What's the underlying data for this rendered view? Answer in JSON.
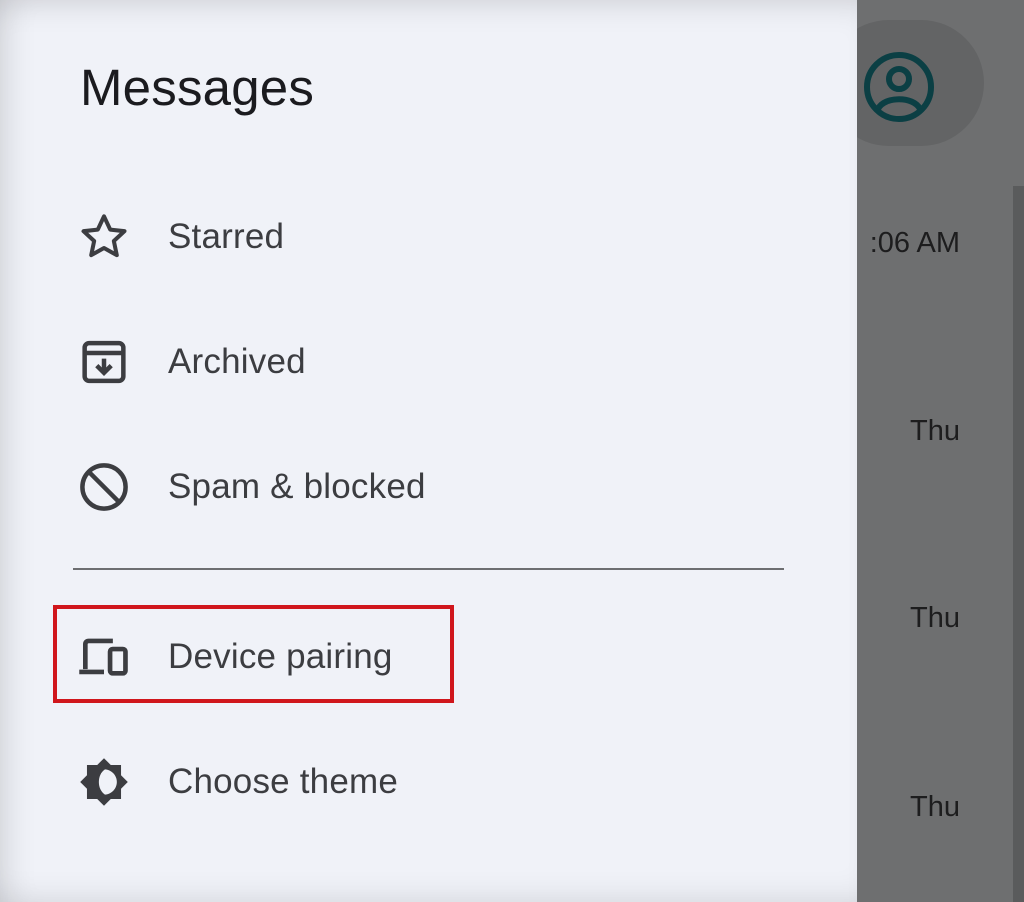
{
  "drawer": {
    "title": "Messages",
    "items": [
      {
        "label": "Starred",
        "icon": "star-icon"
      },
      {
        "label": "Archived",
        "icon": "archive-icon"
      },
      {
        "label": "Spam & blocked",
        "icon": "block-icon"
      },
      {
        "label": "Device pairing",
        "icon": "devices-icon"
      },
      {
        "label": "Choose theme",
        "icon": "theme-icon"
      }
    ],
    "highlighted_item": "Device pairing"
  },
  "background": {
    "avatar_icon": "account-circle-icon",
    "conversation_times": [
      ":06 AM",
      "Thu",
      "Thu",
      "Thu"
    ]
  },
  "colors": {
    "drawer_bg": "#f0f2f8",
    "scrim": "#6e6f70",
    "highlight": "#d0161c",
    "avatar_icon": "#0b3f44"
  }
}
